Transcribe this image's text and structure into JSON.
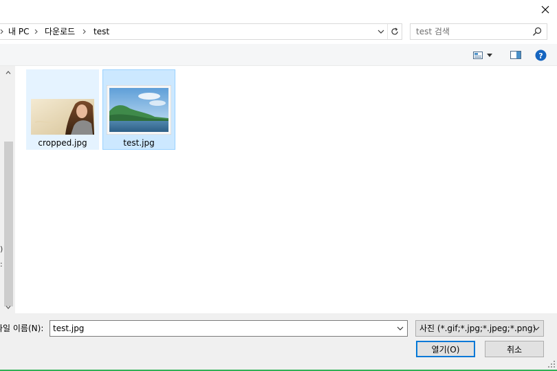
{
  "window": {
    "close_icon": "close-icon"
  },
  "address_bar": {
    "crumbs": [
      "내 PC",
      "다운로드",
      "test"
    ]
  },
  "search": {
    "placeholder": "test 검색"
  },
  "toolbar": {
    "view_icon": "view-options-icon",
    "preview_icon": "preview-pane-icon",
    "help_icon": "help-icon",
    "help_label": "?"
  },
  "nav_pane": {
    "clipped_text": [
      ")",
      ":"
    ]
  },
  "files": [
    {
      "name": "cropped.jpg",
      "state": "hover"
    },
    {
      "name": "test.jpg",
      "state": "selected"
    }
  ],
  "bottom": {
    "filename_label": "파일 이름(N):",
    "filename_value": "test.jpg",
    "filetype_value": "사진 (*.gif;*.jpg;*.jpeg;*.png)",
    "open_label": "열기(O)",
    "cancel_label": "취소"
  },
  "colors": {
    "selected_bg": "#cce8ff",
    "hover_bg": "#e5f3ff",
    "accent": "#0078d7",
    "help_blue": "#1565c0"
  }
}
